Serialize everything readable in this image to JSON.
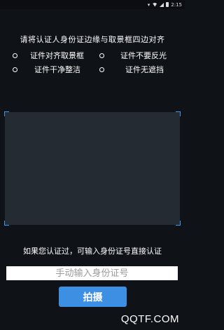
{
  "status_bar": {
    "time": "2:15",
    "icons": [
      "location-icon",
      "wifi-icon",
      "cell-signal-icon",
      "battery-icon"
    ]
  },
  "instruction": "请将认证人身份证边缘与取景框四边对齐",
  "tips": [
    {
      "label": "证件对齐取景框",
      "icon": "radio-circle-icon"
    },
    {
      "label": "证件不要反光",
      "icon": "radio-circle-icon"
    },
    {
      "label": "证件干净整洁",
      "icon": "radio-circle-icon"
    },
    {
      "label": "证件无遮挡",
      "icon": "radio-circle-icon"
    }
  ],
  "manual_hint": "如果您认证过，可输入身份证号直接认证",
  "id_input": {
    "placeholder": "手动输入身份证号",
    "value": ""
  },
  "shoot_button": "拍摄",
  "watermark": "QQTF.COM",
  "colors": {
    "background": "#0f1217",
    "frame": "#252b33",
    "accent": "#3d8fe3",
    "frame_corner": "#3b98ec"
  }
}
